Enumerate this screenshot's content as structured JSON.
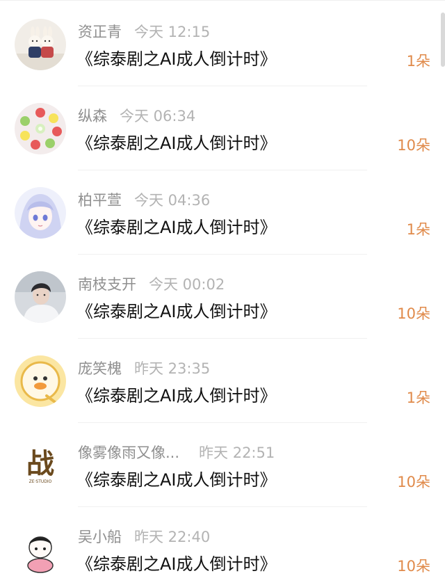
{
  "accent_color": "#e08a4a",
  "entries": [
    {
      "name": "资正青",
      "time": "今天 12:15",
      "title": "《综泰剧之AI成人倒计时》",
      "gift": "1朵",
      "avatar_icon": "bunny-figurines-avatar"
    },
    {
      "name": "纵森",
      "time": "今天 06:34",
      "title": "《综泰剧之AI成人倒计时》",
      "gift": "10朵",
      "avatar_icon": "macaron-cups-avatar"
    },
    {
      "name": "柏平萱",
      "time": "今天 04:36",
      "title": "《综泰剧之AI成人倒计时》",
      "gift": "1朵",
      "avatar_icon": "anime-girl-avatar"
    },
    {
      "name": "南枝支开",
      "time": "今天 00:02",
      "title": "《综泰剧之AI成人倒计时》",
      "gift": "10朵",
      "avatar_icon": "portrait-photo-avatar"
    },
    {
      "name": "庞笑槐",
      "time": "昨天 23:35",
      "title": "《综泰剧之AI成人倒计时》",
      "gift": "1朵",
      "avatar_icon": "duck-cartoon-avatar"
    },
    {
      "name": "像雾像雨又像...",
      "time": "昨天 22:51",
      "title": "《综泰剧之AI成人倒计时》",
      "gift": "10朵",
      "avatar_icon": "calligraphy-logo-avatar",
      "avatar_text": "战",
      "avatar_subtext": "ZE·STUDIO"
    },
    {
      "name": "吴小船",
      "time": "昨天 22:40",
      "title": "《综泰剧之AI成人倒计时》",
      "gift": "10朵",
      "avatar_icon": "chibi-character-avatar"
    }
  ]
}
